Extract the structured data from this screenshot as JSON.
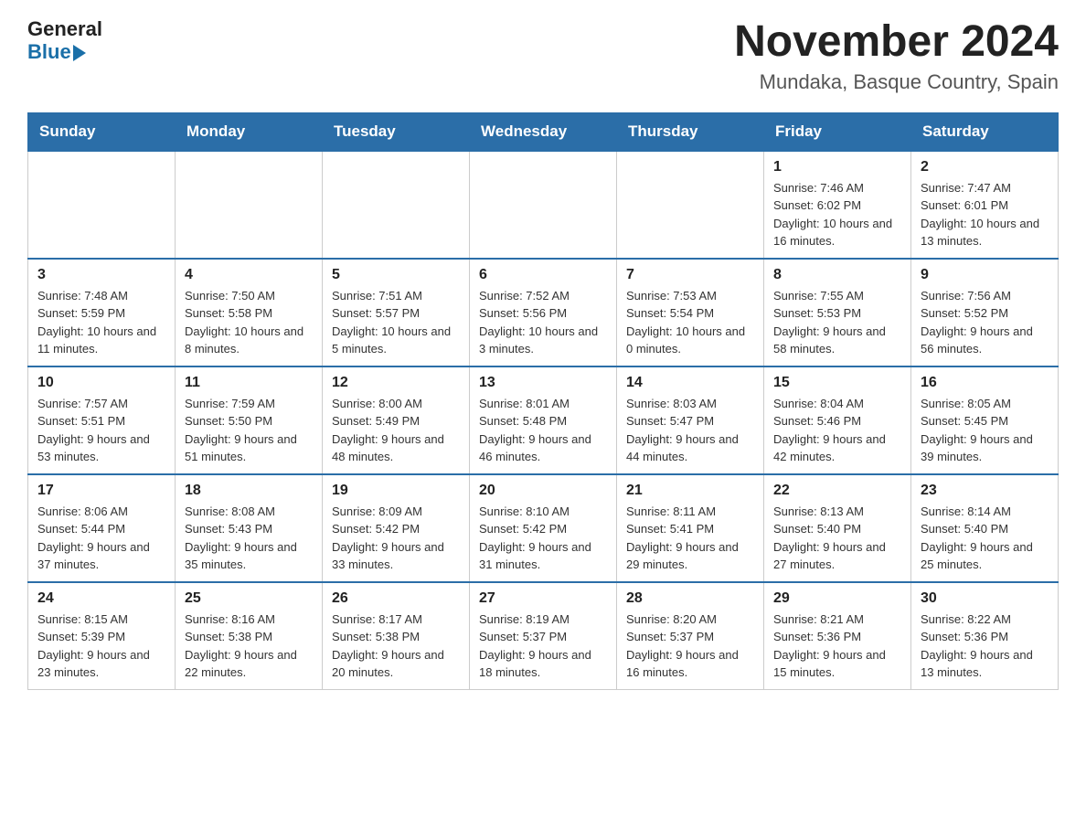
{
  "header": {
    "logo_general": "General",
    "logo_blue": "Blue",
    "main_title": "November 2024",
    "subtitle": "Mundaka, Basque Country, Spain"
  },
  "calendar": {
    "days_of_week": [
      "Sunday",
      "Monday",
      "Tuesday",
      "Wednesday",
      "Thursday",
      "Friday",
      "Saturday"
    ],
    "weeks": [
      [
        {
          "day": "",
          "info": "",
          "empty": true
        },
        {
          "day": "",
          "info": "",
          "empty": true
        },
        {
          "day": "",
          "info": "",
          "empty": true
        },
        {
          "day": "",
          "info": "",
          "empty": true
        },
        {
          "day": "",
          "info": "",
          "empty": true
        },
        {
          "day": "1",
          "info": "Sunrise: 7:46 AM\nSunset: 6:02 PM\nDaylight: 10 hours and 16 minutes."
        },
        {
          "day": "2",
          "info": "Sunrise: 7:47 AM\nSunset: 6:01 PM\nDaylight: 10 hours and 13 minutes."
        }
      ],
      [
        {
          "day": "3",
          "info": "Sunrise: 7:48 AM\nSunset: 5:59 PM\nDaylight: 10 hours and 11 minutes."
        },
        {
          "day": "4",
          "info": "Sunrise: 7:50 AM\nSunset: 5:58 PM\nDaylight: 10 hours and 8 minutes."
        },
        {
          "day": "5",
          "info": "Sunrise: 7:51 AM\nSunset: 5:57 PM\nDaylight: 10 hours and 5 minutes."
        },
        {
          "day": "6",
          "info": "Sunrise: 7:52 AM\nSunset: 5:56 PM\nDaylight: 10 hours and 3 minutes."
        },
        {
          "day": "7",
          "info": "Sunrise: 7:53 AM\nSunset: 5:54 PM\nDaylight: 10 hours and 0 minutes."
        },
        {
          "day": "8",
          "info": "Sunrise: 7:55 AM\nSunset: 5:53 PM\nDaylight: 9 hours and 58 minutes."
        },
        {
          "day": "9",
          "info": "Sunrise: 7:56 AM\nSunset: 5:52 PM\nDaylight: 9 hours and 56 minutes."
        }
      ],
      [
        {
          "day": "10",
          "info": "Sunrise: 7:57 AM\nSunset: 5:51 PM\nDaylight: 9 hours and 53 minutes."
        },
        {
          "day": "11",
          "info": "Sunrise: 7:59 AM\nSunset: 5:50 PM\nDaylight: 9 hours and 51 minutes."
        },
        {
          "day": "12",
          "info": "Sunrise: 8:00 AM\nSunset: 5:49 PM\nDaylight: 9 hours and 48 minutes."
        },
        {
          "day": "13",
          "info": "Sunrise: 8:01 AM\nSunset: 5:48 PM\nDaylight: 9 hours and 46 minutes."
        },
        {
          "day": "14",
          "info": "Sunrise: 8:03 AM\nSunset: 5:47 PM\nDaylight: 9 hours and 44 minutes."
        },
        {
          "day": "15",
          "info": "Sunrise: 8:04 AM\nSunset: 5:46 PM\nDaylight: 9 hours and 42 minutes."
        },
        {
          "day": "16",
          "info": "Sunrise: 8:05 AM\nSunset: 5:45 PM\nDaylight: 9 hours and 39 minutes."
        }
      ],
      [
        {
          "day": "17",
          "info": "Sunrise: 8:06 AM\nSunset: 5:44 PM\nDaylight: 9 hours and 37 minutes."
        },
        {
          "day": "18",
          "info": "Sunrise: 8:08 AM\nSunset: 5:43 PM\nDaylight: 9 hours and 35 minutes."
        },
        {
          "day": "19",
          "info": "Sunrise: 8:09 AM\nSunset: 5:42 PM\nDaylight: 9 hours and 33 minutes."
        },
        {
          "day": "20",
          "info": "Sunrise: 8:10 AM\nSunset: 5:42 PM\nDaylight: 9 hours and 31 minutes."
        },
        {
          "day": "21",
          "info": "Sunrise: 8:11 AM\nSunset: 5:41 PM\nDaylight: 9 hours and 29 minutes."
        },
        {
          "day": "22",
          "info": "Sunrise: 8:13 AM\nSunset: 5:40 PM\nDaylight: 9 hours and 27 minutes."
        },
        {
          "day": "23",
          "info": "Sunrise: 8:14 AM\nSunset: 5:40 PM\nDaylight: 9 hours and 25 minutes."
        }
      ],
      [
        {
          "day": "24",
          "info": "Sunrise: 8:15 AM\nSunset: 5:39 PM\nDaylight: 9 hours and 23 minutes."
        },
        {
          "day": "25",
          "info": "Sunrise: 8:16 AM\nSunset: 5:38 PM\nDaylight: 9 hours and 22 minutes."
        },
        {
          "day": "26",
          "info": "Sunrise: 8:17 AM\nSunset: 5:38 PM\nDaylight: 9 hours and 20 minutes."
        },
        {
          "day": "27",
          "info": "Sunrise: 8:19 AM\nSunset: 5:37 PM\nDaylight: 9 hours and 18 minutes."
        },
        {
          "day": "28",
          "info": "Sunrise: 8:20 AM\nSunset: 5:37 PM\nDaylight: 9 hours and 16 minutes."
        },
        {
          "day": "29",
          "info": "Sunrise: 8:21 AM\nSunset: 5:36 PM\nDaylight: 9 hours and 15 minutes."
        },
        {
          "day": "30",
          "info": "Sunrise: 8:22 AM\nSunset: 5:36 PM\nDaylight: 9 hours and 13 minutes."
        }
      ]
    ]
  }
}
